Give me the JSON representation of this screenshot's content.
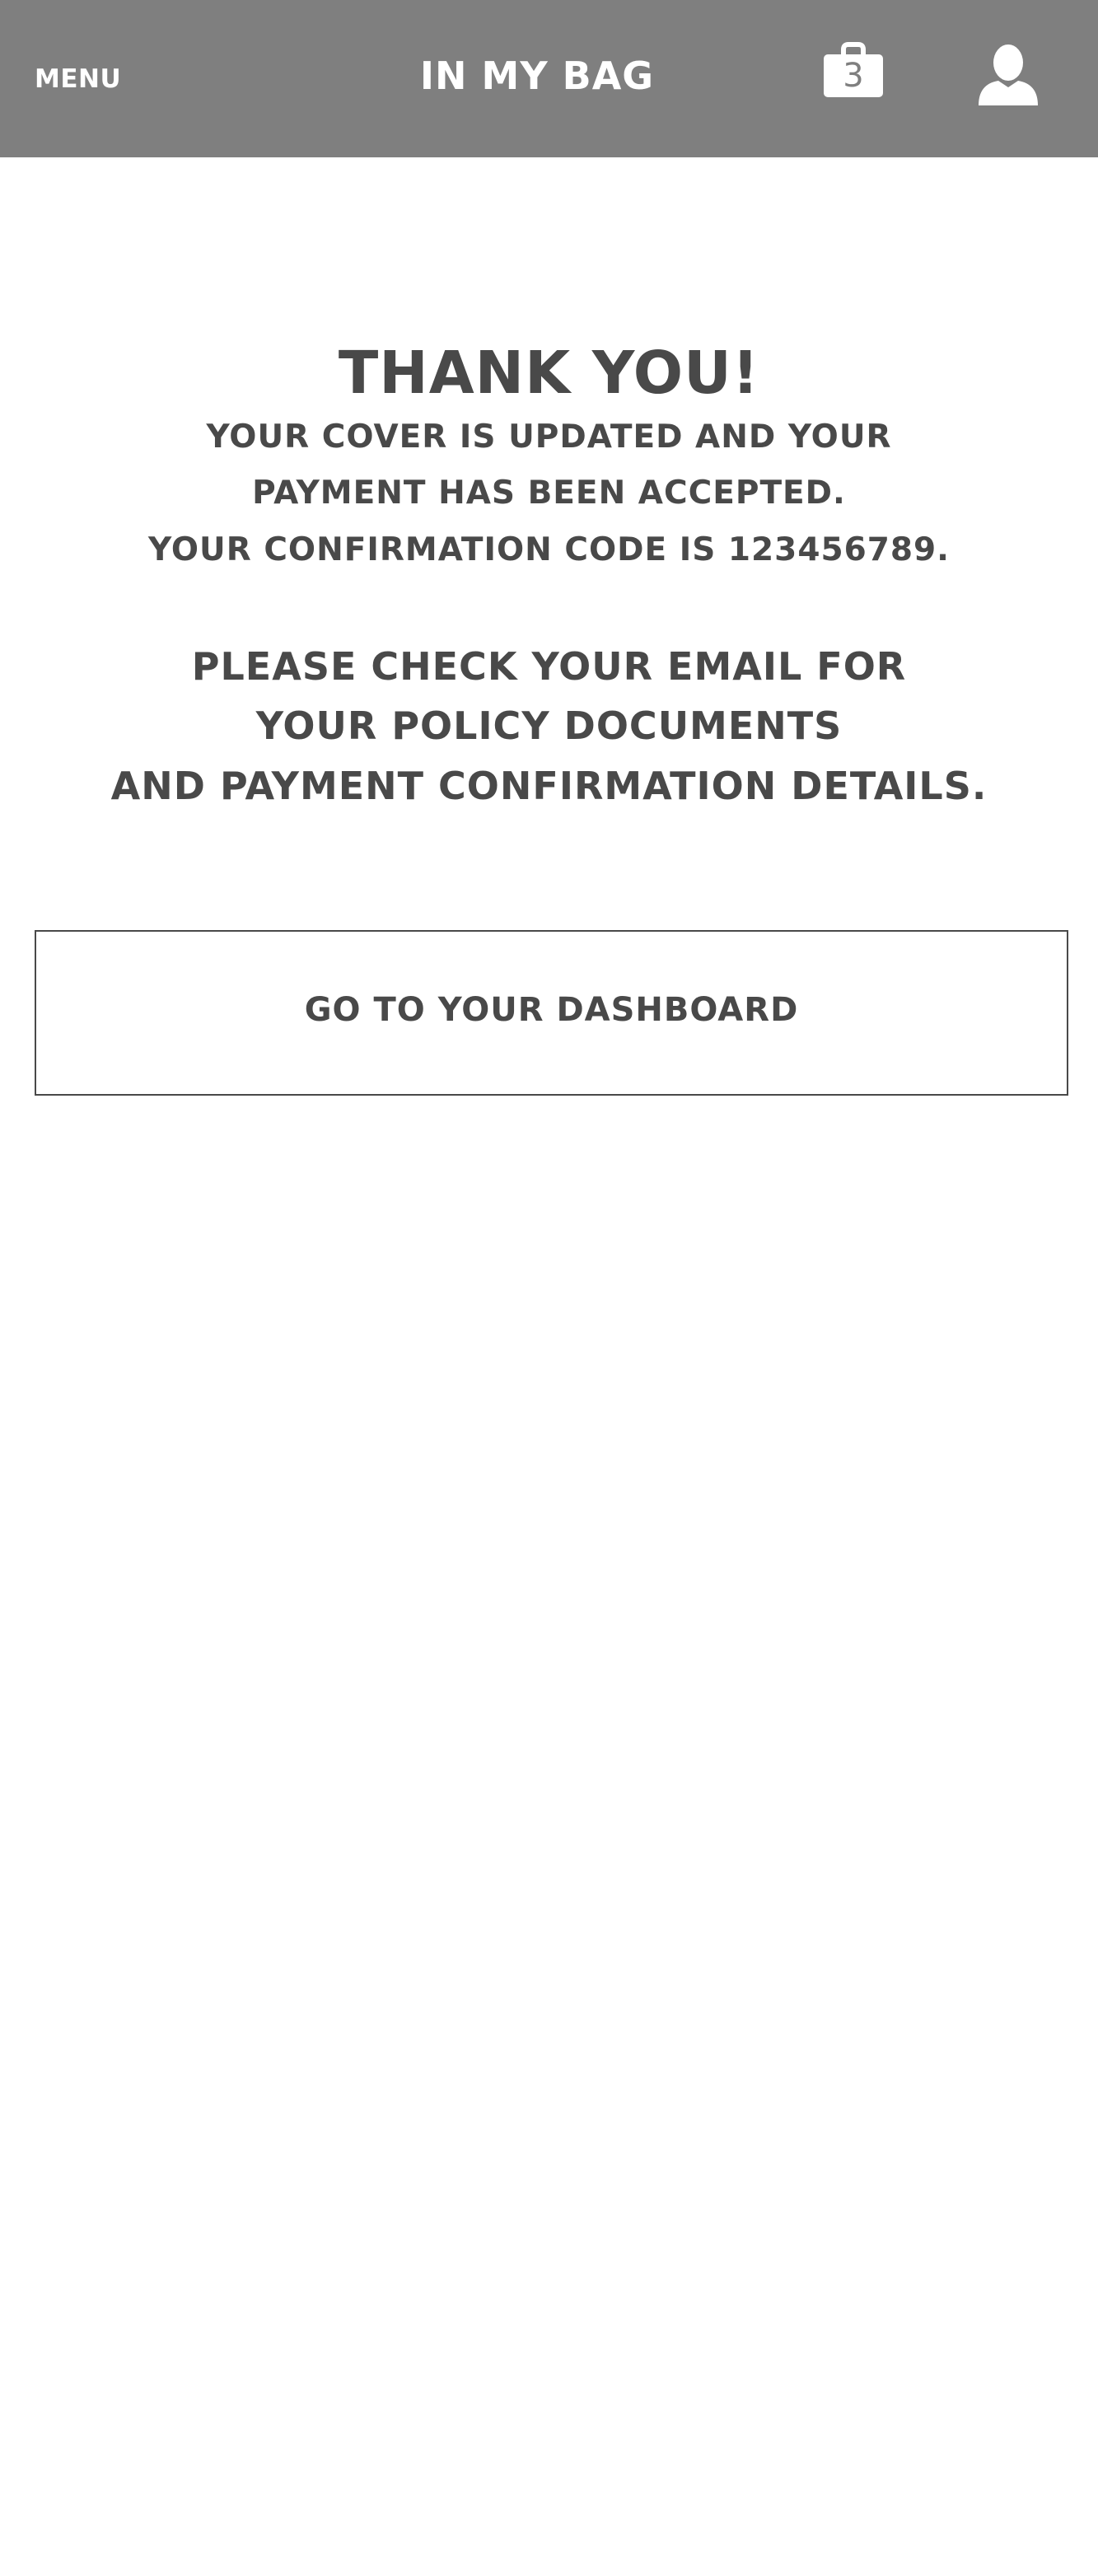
{
  "header": {
    "menu_label": "MENU",
    "title": "IN MY BAG",
    "bag_count": "3",
    "background_color": "#7f7f7f",
    "text_color": "#ffffff",
    "bag_icon": "shopping-bag-icon",
    "user_icon": "user-icon"
  },
  "confirmation": {
    "title": "THANK YOU!",
    "lines": [
      "YOUR COVER IS UPDATED AND YOUR",
      "PAYMENT HAS BEEN ACCEPTED.",
      "YOUR CONFIRMATION CODE IS 123456789."
    ],
    "email_lines": [
      "PLEASE CHECK YOUR EMAIL FOR",
      "YOUR POLICY DOCUMENTS",
      "AND PAYMENT CONFIRMATION DETAILS."
    ],
    "text_color": "#494949"
  },
  "actions": {
    "dashboard_label": "GO TO YOUR DASHBOARD"
  }
}
